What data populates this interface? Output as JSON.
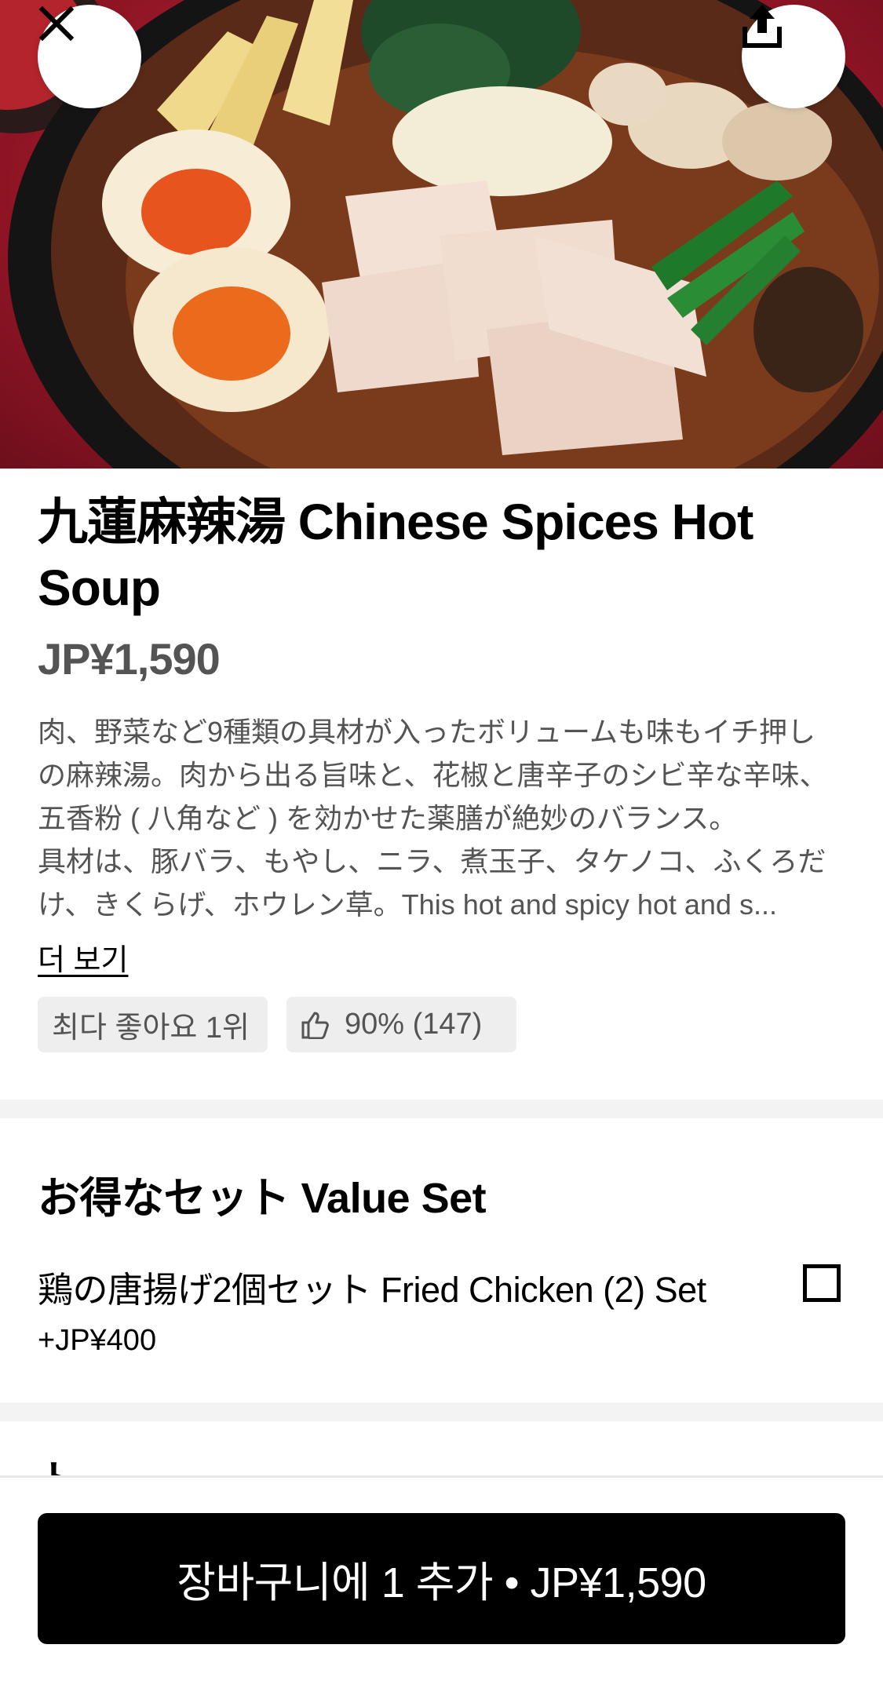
{
  "item": {
    "title": "九蓮麻辣湯 Chinese Spices Hot Soup",
    "price": "JP¥1,590",
    "description_lines": [
      "肉、野菜など9種類の具材が入ったボリュームも味もイチ押し",
      "の麻辣湯。肉から出る旨味と、花椒と唐辛子のシビ辛な辛味、",
      "五香粉 ( 八角など ) を効かせた薬膳が絶妙のバランス。",
      "具材は、豚バラ、もやし、ニラ、煮玉子、タケノコ、ふくろだ",
      "け、きくらげ、ホウレン草。This hot and spicy hot and s..."
    ],
    "more_label": "더 보기",
    "badge_rank": "최다 좋아요 1위",
    "badge_rating": "90% (147)"
  },
  "value_set": {
    "title": "お得なセット Value Set",
    "option_label": "鶏の唐揚げ2個セット Fried Chicken (2) Set",
    "option_price": "+JP¥400",
    "checked": false
  },
  "next_section_peek": "ト",
  "cart": {
    "button_label": "장바구니에 1 추가 • JP¥1,590"
  },
  "icons": {
    "close": "close-icon",
    "share": "share-icon",
    "thumb": "thumbs-up-icon"
  },
  "colors": {
    "primary": "#000000",
    "muted_text": "#545454",
    "badge_bg": "#eeeeee",
    "divider": "#f3f3f3"
  }
}
